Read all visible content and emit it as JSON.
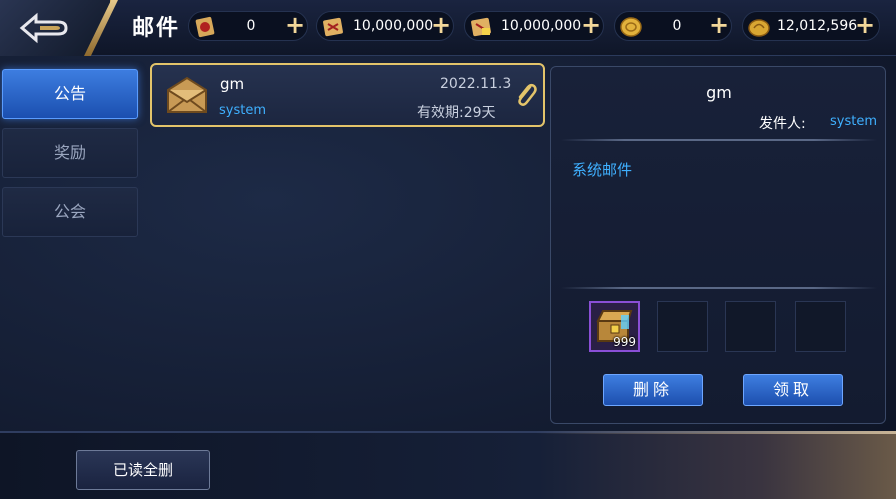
{
  "header": {
    "title": "邮件",
    "back_icon": "back-arrow-icon"
  },
  "resources": [
    {
      "icon": "red-scroll-icon",
      "value": "0"
    },
    {
      "icon": "treasure-map-icon",
      "value": "10,000,000"
    },
    {
      "icon": "locked-map-icon",
      "value": "10,000,000"
    },
    {
      "icon": "gold-coin-icon",
      "value": "0"
    },
    {
      "icon": "gold-ingot-icon",
      "value": "12,012,596"
    }
  ],
  "tabs": [
    {
      "label": "公告",
      "active": true
    },
    {
      "label": "奖励",
      "active": false
    },
    {
      "label": "公会",
      "active": false
    }
  ],
  "mail_list": [
    {
      "title": "gm",
      "sender": "system",
      "date": "2022.11.3",
      "expiry": "有效期:29天",
      "has_attachment": true
    }
  ],
  "detail": {
    "title": "gm",
    "sender_label": "发件人:",
    "sender": "system",
    "body": "系统邮件",
    "attachments": [
      {
        "icon": "treasure-chest-icon",
        "count": "999"
      },
      null,
      null,
      null
    ],
    "delete_label": "删除",
    "claim_label": "领取"
  },
  "footer": {
    "clear_read_label": "已读全删"
  },
  "colors": {
    "accent_blue": "#3fb0ff",
    "gold": "#e3c46a",
    "button_blue": "#2f66c8"
  }
}
